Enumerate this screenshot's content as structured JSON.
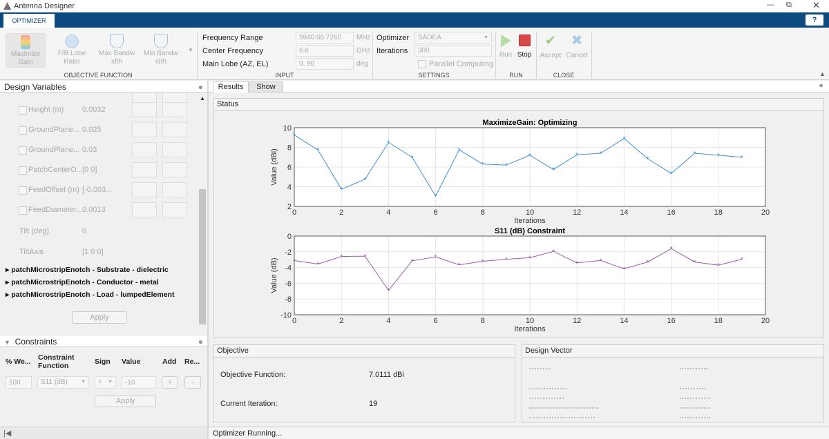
{
  "window": {
    "title": "Antenna Designer",
    "icon": "matlab-logo-icon"
  },
  "ribbon": {
    "tab": "OPTIMIZER",
    "help": "?",
    "objective": {
      "label": "OBJECTIVE FUNCTION",
      "buttons": [
        {
          "l1": "Maximize",
          "l2": "Gain"
        },
        {
          "l1": "F/B Lobe",
          "l2": "Ratio"
        },
        {
          "l1": "Max Bandw",
          "l2": "idth"
        },
        {
          "l1": "Min Bandw",
          "l2": "idth"
        }
      ]
    },
    "input": {
      "label": "INPUT",
      "freq_range_label": "Frequency Range",
      "freq_range": "5940:66:7260",
      "freq_unit": "MHz",
      "center_label": "Center Frequency",
      "center": "6.6",
      "center_unit": "GHz",
      "lobe_label": "Main Lobe (AZ, EL)",
      "lobe": "0, 90",
      "lobe_unit": "deg"
    },
    "settings": {
      "label": "SETTINGS",
      "optimizer_label": "Optimizer",
      "optimizer": "SADEA",
      "iterations_label": "Iterations",
      "iterations": "300",
      "parallel": "Parallel Computing",
      "parallel_checked": false
    },
    "run": {
      "label": "RUN",
      "run": "Run",
      "stop": "Stop"
    },
    "close": {
      "label": "CLOSE",
      "accept": "Accept",
      "cancel": "Cancel"
    }
  },
  "design_variables": {
    "title": "Design Variables",
    "rows": [
      {
        "name": "Height (m)",
        "value": "0.0032"
      },
      {
        "name": "GroundPlane...",
        "value": "0.025"
      },
      {
        "name": "GroundPlane...",
        "value": "0.03"
      },
      {
        "name": "PatchCenterO...",
        "value": "[0 0]"
      },
      {
        "name": "FeedOffset (m)",
        "value": "[-0.003..."
      },
      {
        "name": "FeedDiameter...",
        "value": "0.0013"
      }
    ],
    "plain": [
      {
        "name": "Tilt (deg)",
        "value": "0"
      },
      {
        "name": "TiltAxis",
        "value": "[1 0 0]"
      }
    ],
    "tree": [
      "patchMicrostripEnotch - Substrate - dielectric",
      "patchMicrostripEnotch - Conductor - metal",
      "patchMicrostripEnotch - Load - lumpedElement"
    ],
    "apply": "Apply"
  },
  "constraints": {
    "title": "Constraints",
    "headers": [
      "% We...",
      "Constraint Function",
      "Sign",
      "Value",
      "Add",
      "Re..."
    ],
    "weight": "100",
    "function": "S11 (dB)",
    "sign": "<",
    "value": "-10",
    "add": "+",
    "remove": "-",
    "apply": "Apply"
  },
  "results": {
    "tabs": [
      "Results",
      "Show"
    ],
    "status_title": "Status"
  },
  "objective": {
    "title": "Objective",
    "fn_label": "Objective Function:",
    "fn_value": "7.0111 dBi",
    "iter_label": "Current Iteration:",
    "iter_value": "19"
  },
  "design_vector": {
    "title": "Design Vector"
  },
  "statusbar": {
    "text": "Optimizer Running..."
  },
  "chart_data": [
    {
      "type": "line",
      "title": "MaximizeGain: Optimizing",
      "xlabel": "Iterations",
      "ylabel": "Value (dBi)",
      "xlim": [
        0,
        20
      ],
      "ylim": [
        2,
        10
      ],
      "xticks": [
        0,
        2,
        4,
        6,
        8,
        10,
        12,
        14,
        16,
        18,
        20
      ],
      "yticks": [
        2,
        4,
        6,
        8,
        10
      ],
      "grid": true,
      "color": "#3d8fd1",
      "x": [
        0,
        1,
        2,
        3,
        4,
        5,
        6,
        7,
        8,
        9,
        10,
        11,
        12,
        13,
        14,
        15,
        16,
        17,
        18,
        19
      ],
      "y": [
        9.25,
        7.75,
        3.75,
        4.75,
        8.5,
        7.0,
        3.05,
        7.75,
        6.3,
        6.2,
        7.2,
        5.75,
        7.25,
        7.4,
        8.9,
        6.85,
        5.35,
        7.4,
        7.2,
        7.0
      ]
    },
    {
      "type": "line",
      "title": "S11 (dB) Constraint",
      "xlabel": "Iterations",
      "ylabel": "Value (dB)",
      "xlim": [
        0,
        20
      ],
      "ylim": [
        -10,
        0
      ],
      "xticks": [
        0,
        2,
        4,
        6,
        8,
        10,
        12,
        14,
        16,
        18,
        20
      ],
      "yticks": [
        -10,
        -8,
        -6,
        -4,
        -2,
        0
      ],
      "grid": true,
      "color": "#9b5aa8",
      "x": [
        0,
        1,
        2,
        3,
        4,
        5,
        6,
        7,
        8,
        9,
        10,
        11,
        12,
        13,
        14,
        15,
        16,
        17,
        18,
        19
      ],
      "y": [
        -3.1,
        -3.55,
        -2.6,
        -2.55,
        -6.9,
        -3.15,
        -2.65,
        -3.65,
        -3.2,
        -2.95,
        -2.75,
        -1.95,
        -3.4,
        -3.1,
        -4.15,
        -3.3,
        -1.6,
        -3.3,
        -3.7,
        -2.95
      ]
    }
  ]
}
